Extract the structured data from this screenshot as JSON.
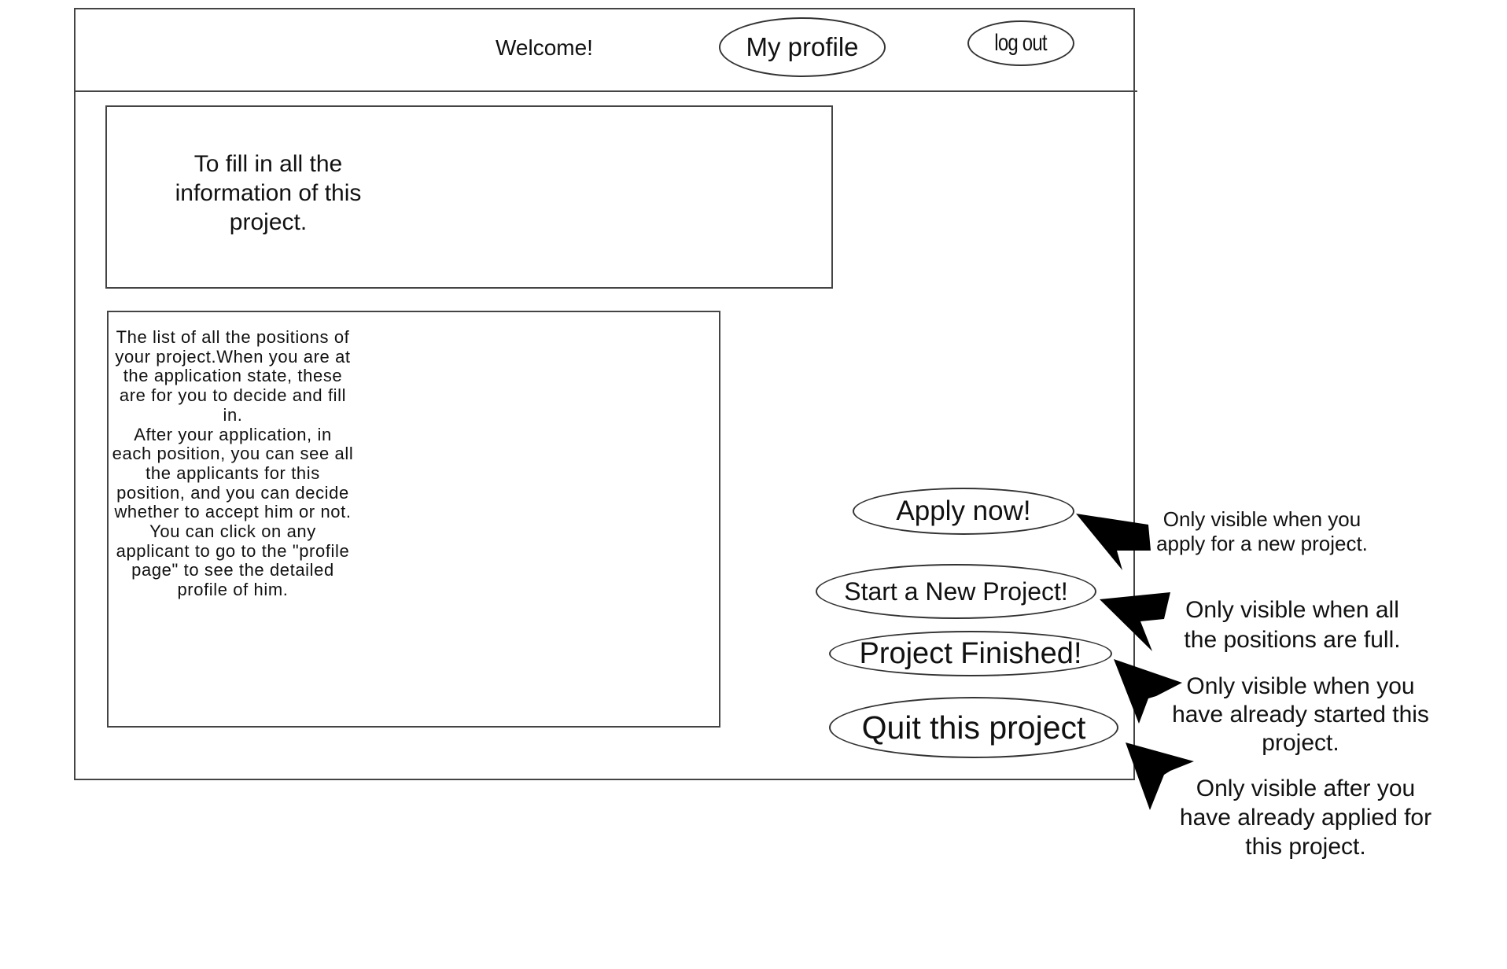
{
  "header": {
    "welcome_text": "Welcome!",
    "my_profile_label": "My profile",
    "log_out_label": "log out"
  },
  "project_info_box": {
    "text": "To fill in all the information of this project."
  },
  "positions_box": {
    "paragraphs": [
      "The list of all the positions of your project.When you are at the application state, these are for you to decide and fill in.",
      "After your application, in each position, you can see all the applicants for this position, and you can decide whether to accept him or not.",
      "You can click on any applicant to go to the \"profile page\" to see the detailed profile of him."
    ]
  },
  "actions": {
    "apply_now_label": "Apply now!",
    "start_new_project_label": "Start a New Project!",
    "project_finished_label": "Project Finished!",
    "quit_project_label": "Quit this project"
  },
  "annotations": {
    "apply_now_note": "Only visible when you apply for a new project.",
    "start_new_project_note": "Only visible when all the positions are full.",
    "project_finished_note": "Only visible when you have already started this project.",
    "quit_project_note": "Only visible after you have already applied for this project."
  },
  "colors": {
    "stroke": "#444444",
    "arrow": "#000000",
    "background": "#ffffff"
  }
}
